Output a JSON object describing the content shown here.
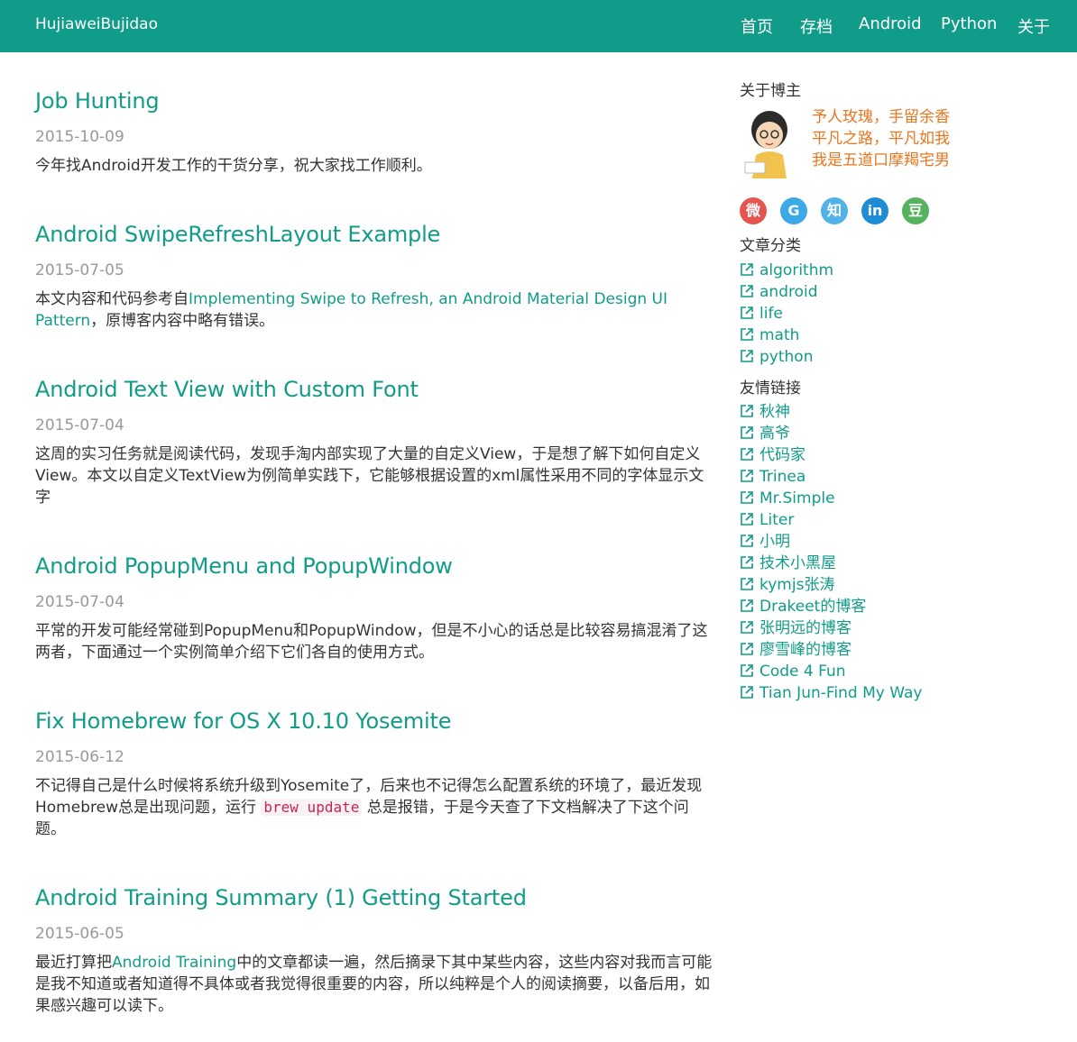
{
  "nav": {
    "brand": "HujiaweiBujidao",
    "links": [
      "首页",
      "存档",
      "Android",
      "Python",
      "关于"
    ]
  },
  "posts": [
    {
      "title": "Job Hunting",
      "date": "2015-10-09",
      "excerpt": "今年找Android开发工作的干货分享，祝大家找工作顺利。"
    },
    {
      "title": "Android SwipeRefreshLayout Example",
      "date": "2015-07-05",
      "excerpt_before": "本文内容和代码参考自",
      "excerpt_link": "Implementing Swipe to Refresh, an Android Material Design UI Pattern",
      "excerpt_after": "，原博客内容中略有错误。"
    },
    {
      "title": "Android Text View with Custom Font",
      "date": "2015-07-04",
      "excerpt": "这周的实习任务就是阅读代码，发现手淘内部实现了大量的自定义View，于是想了解下如何自定义View。本文以自定义TextView为例简单实践下，它能够根据设置的xml属性采用不同的字体显示文字"
    },
    {
      "title": "Android PopupMenu and PopupWindow",
      "date": "2015-07-04",
      "excerpt": "平常的开发可能经常碰到PopupMenu和PopupWindow，但是不小心的话总是比较容易搞混淆了这两者，下面通过一个实例简单介绍下它们各自的使用方式。"
    },
    {
      "title": "Fix Homebrew for OS X 10.10 Yosemite",
      "date": "2015-06-12",
      "excerpt_before": "不记得自己是什么时候将系统升级到Yosemite了，后来也不记得怎么配置系统的环境了，最近发现Homebrew总是出现问题，运行 ",
      "excerpt_code": "brew update",
      "excerpt_after": " 总是报错，于是今天查了下文档解决了下这个问题。"
    },
    {
      "title": "Android Training Summary (1) Getting Started",
      "date": "2015-06-05",
      "excerpt_before": "最近打算把",
      "excerpt_link": "Android Training",
      "excerpt_after": "中的文章都读一遍，然后摘录下其中某些内容，这些内容对我而言可能是我不知道或者知道得不具体或者我觉得很重要的内容，所以纯粹是个人的阅读摘要，以备后用，如果感兴趣可以读下。"
    }
  ],
  "sidebar": {
    "about_heading": "关于博主",
    "motto": [
      "予人玫瑰，手留余香",
      "平凡之路，平凡如我",
      "我是五道口摩羯宅男"
    ],
    "social": [
      {
        "name": "weibo-icon",
        "glyph": "微",
        "color": "#e6544f"
      },
      {
        "name": "github-icon",
        "glyph": "G",
        "color": "#3ba9e6"
      },
      {
        "name": "zhihu-icon",
        "glyph": "知",
        "color": "#4fb3e8"
      },
      {
        "name": "linkedin-icon",
        "glyph": "in",
        "color": "#1f8dd6"
      },
      {
        "name": "douban-icon",
        "glyph": "豆",
        "color": "#55b25e"
      }
    ],
    "categories_heading": "文章分类",
    "categories": [
      "algorithm",
      "android",
      "life",
      "math",
      "python"
    ],
    "links_heading": "友情链接",
    "friend_links": [
      "秋神",
      "高爷",
      "代码家",
      "Trinea",
      "Mr.Simple",
      "Liter",
      "小明",
      "技术小黑屋",
      "kymjs张涛",
      "Drakeet的博客",
      "张明远的博客",
      "廖雪峰的博客",
      "Code 4 Fun",
      "Tian Jun-Find My Way"
    ]
  },
  "colors": {
    "accent": "#119c8a",
    "motto": "#e8761f",
    "date": "#999999",
    "code": "#c7254e"
  }
}
